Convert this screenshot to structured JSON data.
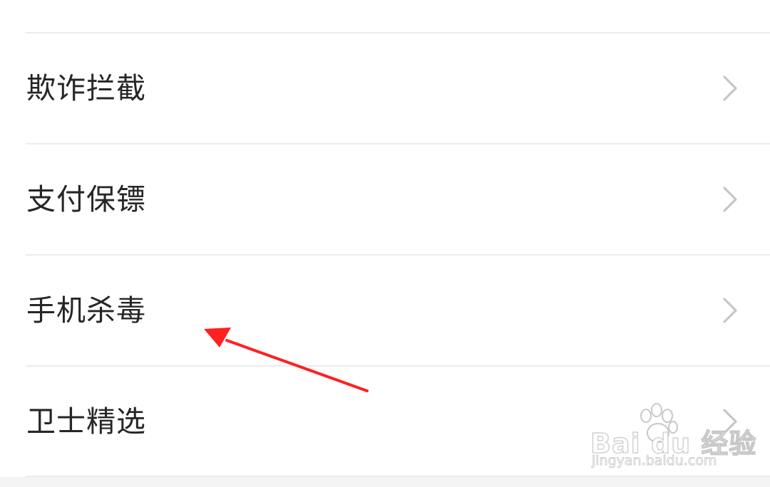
{
  "menu": {
    "items": [
      {
        "label": "欺诈拦截",
        "icon": "chevron-right-icon"
      },
      {
        "label": "支付保镖",
        "icon": "chevron-right-icon"
      },
      {
        "label": "手机杀毒",
        "icon": "chevron-right-icon"
      },
      {
        "label": "卫士精选",
        "icon": "chevron-right-icon"
      }
    ]
  },
  "annotation": {
    "arrow_color": "#ff2020",
    "points_to": "手机杀毒"
  },
  "watermark": {
    "brand": "Bai du 经验",
    "url": "jingyan.baidu.com"
  },
  "colors": {
    "label_text": "#262626",
    "divider": "#ececec",
    "chevron": "#c6c6c6"
  }
}
